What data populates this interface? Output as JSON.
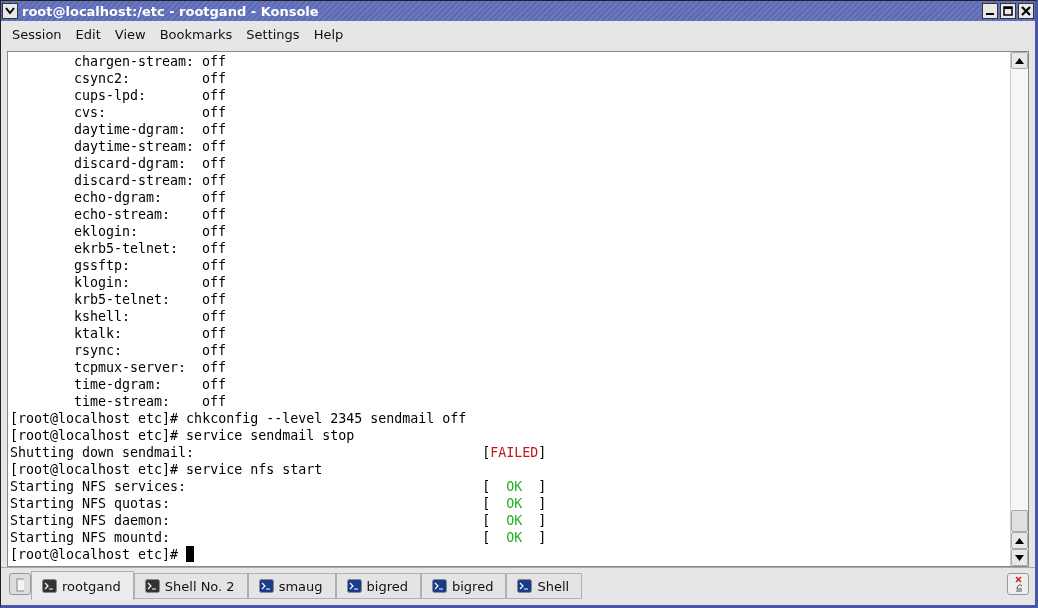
{
  "window": {
    "title": "root@localhost:/etc - rootgand - Konsole"
  },
  "menu": [
    "Session",
    "Edit",
    "View",
    "Bookmarks",
    "Settings",
    "Help"
  ],
  "terminal": {
    "lines": [
      {
        "kind": "service",
        "name": "chargen-stream:",
        "value": "off"
      },
      {
        "kind": "service",
        "name": "csync2:",
        "value": "off"
      },
      {
        "kind": "service",
        "name": "cups-lpd:",
        "value": "off"
      },
      {
        "kind": "service",
        "name": "cvs:",
        "value": "off"
      },
      {
        "kind": "service",
        "name": "daytime-dgram:",
        "value": "off"
      },
      {
        "kind": "service",
        "name": "daytime-stream:",
        "value": "off"
      },
      {
        "kind": "service",
        "name": "discard-dgram:",
        "value": "off"
      },
      {
        "kind": "service",
        "name": "discard-stream:",
        "value": "off"
      },
      {
        "kind": "service",
        "name": "echo-dgram:",
        "value": "off"
      },
      {
        "kind": "service",
        "name": "echo-stream:",
        "value": "off"
      },
      {
        "kind": "service",
        "name": "eklogin:",
        "value": "off"
      },
      {
        "kind": "service",
        "name": "ekrb5-telnet:",
        "value": "off"
      },
      {
        "kind": "service",
        "name": "gssftp:",
        "value": "off"
      },
      {
        "kind": "service",
        "name": "klogin:",
        "value": "off"
      },
      {
        "kind": "service",
        "name": "krb5-telnet:",
        "value": "off"
      },
      {
        "kind": "service",
        "name": "kshell:",
        "value": "off"
      },
      {
        "kind": "service",
        "name": "ktalk:",
        "value": "off"
      },
      {
        "kind": "service",
        "name": "rsync:",
        "value": "off"
      },
      {
        "kind": "service",
        "name": "tcpmux-server:",
        "value": "off"
      },
      {
        "kind": "service",
        "name": "time-dgram:",
        "value": "off"
      },
      {
        "kind": "service",
        "name": "time-stream:",
        "value": "off"
      },
      {
        "kind": "prompt",
        "text": "[root@localhost etc]# chkconfig --level 2345 sendmail off",
        "cursor": false
      },
      {
        "kind": "prompt",
        "text": "[root@localhost etc]# service sendmail stop",
        "cursor": false
      },
      {
        "kind": "status",
        "text": "Shutting down sendmail:",
        "open": "[",
        "status": "FAILED",
        "close": "]",
        "color": "#c01818"
      },
      {
        "kind": "prompt",
        "text": "[root@localhost etc]# service nfs start",
        "cursor": false
      },
      {
        "kind": "status",
        "text": "Starting NFS services:",
        "open": "[",
        "status": "OK",
        "close": "]",
        "color": "#1fb31f"
      },
      {
        "kind": "status",
        "text": "Starting NFS quotas:",
        "open": "[",
        "status": "OK",
        "close": "]",
        "color": "#1fb31f"
      },
      {
        "kind": "status",
        "text": "Starting NFS daemon:",
        "open": "[",
        "status": "OK",
        "close": "]",
        "color": "#1fb31f"
      },
      {
        "kind": "status",
        "text": "Starting NFS mountd:",
        "open": "[",
        "status": "OK",
        "close": "]",
        "color": "#1fb31f"
      },
      {
        "kind": "prompt",
        "text": "[root@localhost etc]#",
        "cursor": true
      }
    ]
  },
  "tabs": [
    {
      "label": "rootgand",
      "kind": "local",
      "selected": true
    },
    {
      "label": "Shell No. 2",
      "kind": "local",
      "selected": false
    },
    {
      "label": "smaug",
      "kind": "remote",
      "selected": false
    },
    {
      "label": "bigred",
      "kind": "remote",
      "selected": false
    },
    {
      "label": "bigred",
      "kind": "remote",
      "selected": false
    },
    {
      "label": "Shell",
      "kind": "remote",
      "selected": false
    }
  ]
}
